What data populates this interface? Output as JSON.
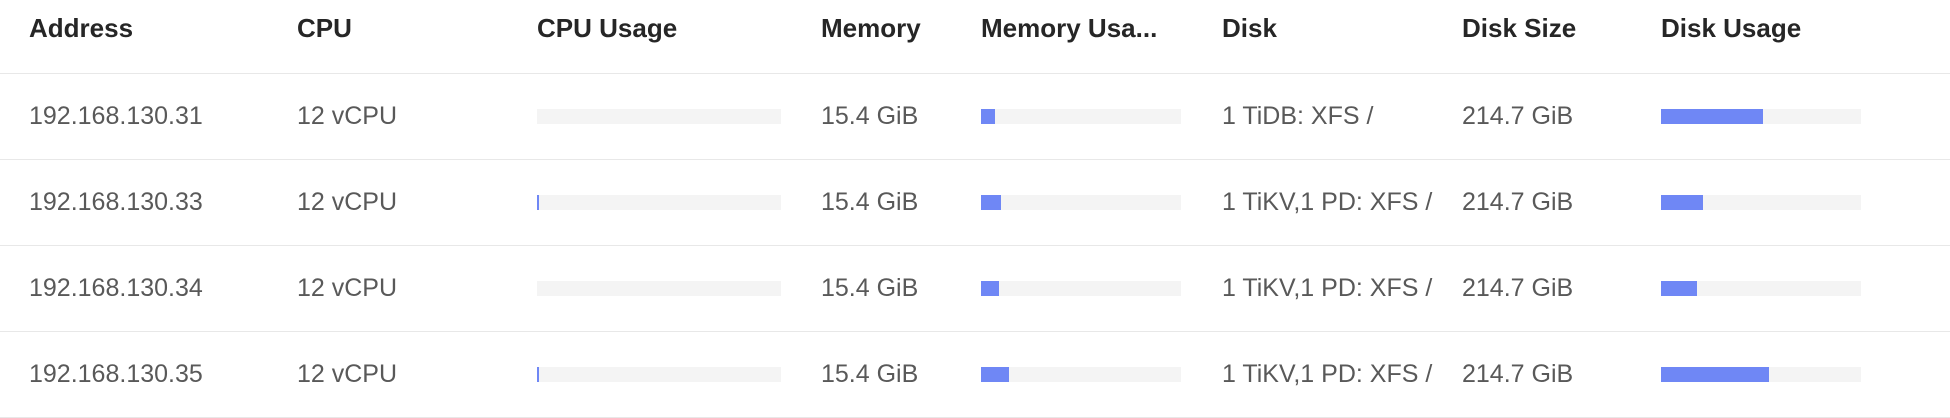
{
  "columns": {
    "address": "Address",
    "cpu": "CPU",
    "cpu_usage": "CPU Usage",
    "memory": "Memory",
    "memory_usage": "Memory Usa...",
    "disk": "Disk",
    "disk_size": "Disk Size",
    "disk_usage": "Disk Usage"
  },
  "colors": {
    "bar_fill": "#6f87f5",
    "bar_track": "#f4f4f4"
  },
  "rows": [
    {
      "address": "192.168.130.31",
      "cpu": "12 vCPU",
      "cpu_usage": 0.0,
      "memory": "15.4 GiB",
      "memory_usage": 0.07,
      "disk": "1 TiDB: XFS /",
      "disk_size": "214.7 GiB",
      "disk_usage": 0.51
    },
    {
      "address": "192.168.130.33",
      "cpu": "12 vCPU",
      "cpu_usage": 0.008,
      "memory": "15.4 GiB",
      "memory_usage": 0.1,
      "disk": "1 TiKV,1 PD: XFS /",
      "disk_size": "214.7 GiB",
      "disk_usage": 0.21
    },
    {
      "address": "192.168.130.34",
      "cpu": "12 vCPU",
      "cpu_usage": 0.0,
      "memory": "15.4 GiB",
      "memory_usage": 0.09,
      "disk": "1 TiKV,1 PD: XFS /",
      "disk_size": "214.7 GiB",
      "disk_usage": 0.18
    },
    {
      "address": "192.168.130.35",
      "cpu": "12 vCPU",
      "cpu_usage": 0.008,
      "memory": "15.4 GiB",
      "memory_usage": 0.14,
      "disk": "1 TiKV,1 PD: XFS /",
      "disk_size": "214.7 GiB",
      "disk_usage": 0.54
    }
  ]
}
